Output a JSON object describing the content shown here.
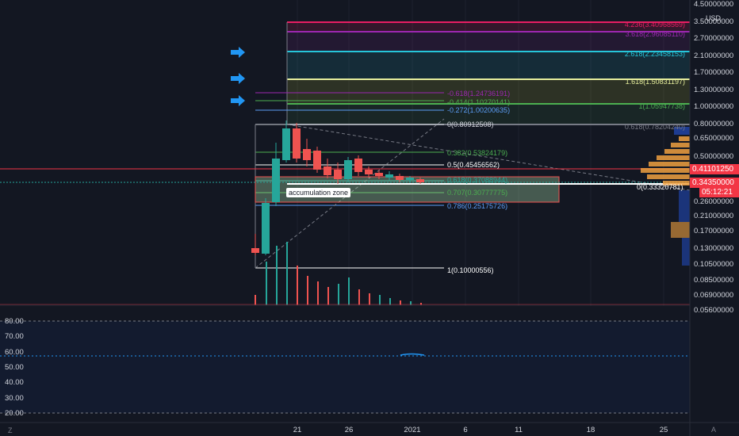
{
  "header": {
    "currency": "USD",
    "scale_mode_label": "A",
    "scale_left_label": "Z"
  },
  "price_axis": {
    "labels": [
      "4.50000000",
      "3.50000000",
      "2.70000000",
      "2.10000000",
      "1.70000000",
      "1.30000000",
      "1.00000000",
      "0.80000000",
      "0.65000000",
      "0.50000000",
      "0.41101250",
      "0.34350000",
      "0.26000000",
      "0.21000000",
      "0.17000000",
      "0.13000000",
      "0.10500000",
      "0.08500000",
      "0.06900000",
      "0.05600000"
    ],
    "current_price": "0.41101250",
    "last_price": "0.34350000",
    "countdown": "05:12:21"
  },
  "time_axis": {
    "labels": [
      "21",
      "26",
      "2021",
      "6",
      "11",
      "18",
      "25"
    ]
  },
  "oscillator_axis": {
    "labels": [
      "80.00",
      "70.00",
      "60.00",
      "50.00",
      "40.00",
      "30.00",
      "20.00"
    ]
  },
  "fib_extension": {
    "levels": [
      {
        "label": "4.236(3.40968569)",
        "color": "#e91e63"
      },
      {
        "label": "3.618(2.96085110)",
        "color": "#9c27b0"
      },
      {
        "label": "2.618(2.23458153)",
        "color": "#26c6da"
      },
      {
        "label": "1.618(1.50831197)",
        "color": "#e6ee9c"
      },
      {
        "label": "1(1.05947738)",
        "color": "#4caf50"
      },
      {
        "label": "0.618(0.78204240)",
        "color": "#787b86"
      }
    ]
  },
  "fib_retracement": {
    "levels": [
      {
        "label": "-0.618(1.24736191)",
        "color": "#9c27b0"
      },
      {
        "label": "-0.414(1.10270141)",
        "color": "#4caf50"
      },
      {
        "label": "-0.272(1.00200635)",
        "color": "#5b9cf6"
      },
      {
        "label": "0(0.80912508)",
        "color": "#d1d4dc"
      },
      {
        "label": "0.382(0.53824179)",
        "color": "#4caf50"
      },
      {
        "label": "0.5(0.45456562)",
        "color": "#ffffff"
      },
      {
        "label": "0.618(0.37088944)",
        "color": "#26a69a"
      },
      {
        "label": "0.707(0.30777775)",
        "color": "#4caf50"
      },
      {
        "label": "0.786(0.25175726)",
        "color": "#5b9cf6"
      },
      {
        "label": "1(0.10000556)",
        "color": "#ffffff"
      }
    ],
    "extra_level": {
      "label": "0(0.33320781)",
      "color": "#ffffff"
    }
  },
  "annotations": {
    "accumulation_zone": "accumulation zone"
  },
  "colors": {
    "up": "#26a69a",
    "down": "#ef5350",
    "accent": "#2196f3",
    "background": "#131722"
  }
}
